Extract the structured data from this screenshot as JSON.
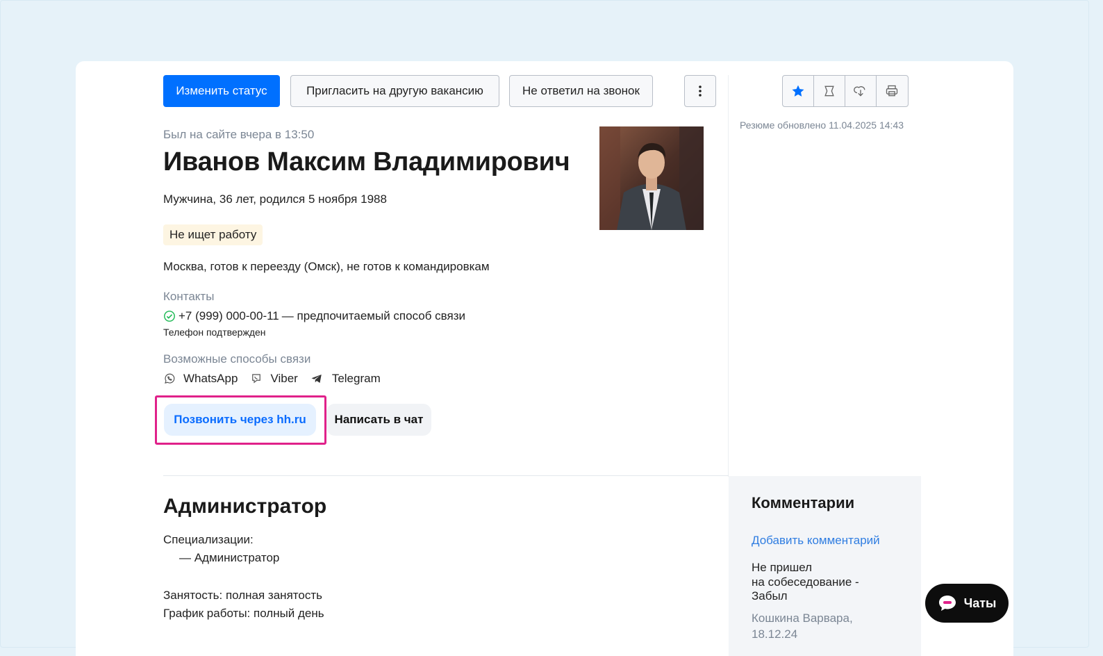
{
  "toolbar": {
    "change_status": "Изменить статус",
    "invite_other": "Пригласить на другую вакансию",
    "no_answer": "Не ответил на звонок",
    "more_icon": "more-vertical-icon",
    "right_icons": [
      "star-icon",
      "compare-icon",
      "download-icon",
      "print-icon"
    ]
  },
  "profile": {
    "last_seen": "Был на сайте вчера в 13:50",
    "name": "Иванов Максим Владимирович",
    "info": "Мужчина, 36 лет, родился 5 ноября 1988",
    "job_status": "Не ищет работу",
    "location": "Москва, готов к переезду (Омск), не готов к командировкам"
  },
  "contacts": {
    "heading": "Контакты",
    "phone": "+7 (999) 000-00-11",
    "phone_note": "— предпочитаемый способ связи",
    "phone_verified": "Телефон подтвержден",
    "alt_heading": "Возможные способы связи",
    "messengers": [
      "WhatsApp",
      "Viber",
      "Telegram"
    ]
  },
  "actions": {
    "call": "Позвонить через hh.ru",
    "chat": "Написать в чат"
  },
  "resume": {
    "updated": "Резюме обновлено 11.04.2025 14:43"
  },
  "position": {
    "title": "Администратор",
    "spec_label": "Специализации:",
    "spec_item": "— Администратор",
    "employment": "Занятость: полная занятость",
    "schedule": "График работы: полный день"
  },
  "comments": {
    "title": "Комментарии",
    "add": "Добавить комментарий",
    "items": [
      {
        "line1": "Не пришел",
        "line2": "на собеседование -",
        "line3": "Забыл",
        "author": "Кошкина Варвара,",
        "date": "18.12.24"
      }
    ]
  },
  "chat_fab": {
    "label": "Чаты"
  },
  "colors": {
    "accent": "#0070ff",
    "highlight": "#e0218a",
    "verified": "#1db954"
  }
}
